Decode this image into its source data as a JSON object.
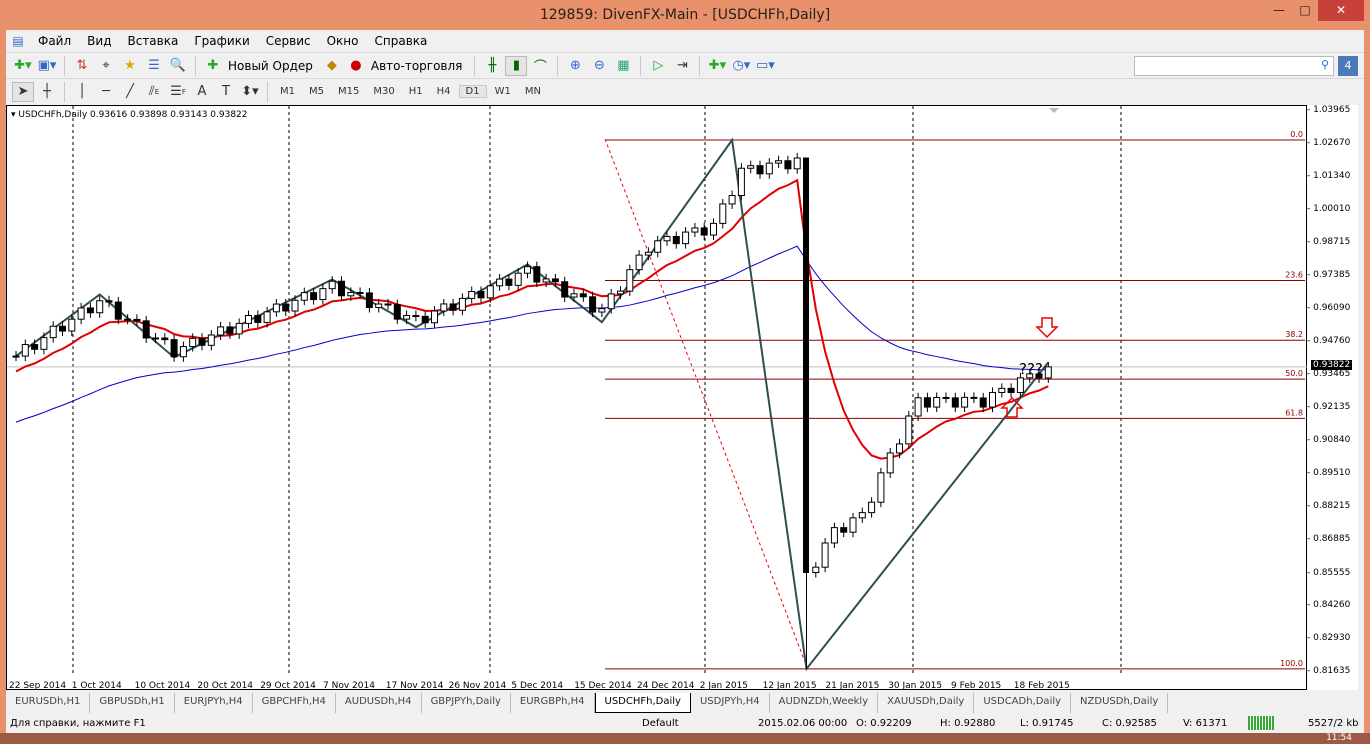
{
  "window": {
    "title": "129859: DivenFX-Main - [USDCHFh,Daily]",
    "minimize": "—",
    "maximize": "□",
    "close": "✕"
  },
  "menu": [
    "Файл",
    "Вид",
    "Вставка",
    "Графики",
    "Сервис",
    "Окно",
    "Справка"
  ],
  "toolbar": {
    "new_order": "Новый Ордер",
    "autotrading": "Авто-торговля"
  },
  "tools": {
    "text": "A",
    "label": "T",
    "fib_e": "E",
    "fib_f": "F"
  },
  "timeframes": [
    "M1",
    "M5",
    "M15",
    "M30",
    "H1",
    "H4",
    "D1",
    "W1",
    "MN"
  ],
  "active_timeframe": "D1",
  "chart": {
    "header": "USDCHFh,Daily  0.93616 0.93898 0.93143 0.93822",
    "current_price": "0.93822",
    "price_ticks": [
      "1.03965",
      "1.02670",
      "1.01340",
      "1.00010",
      "0.98715",
      "0.97385",
      "0.96090",
      "0.94760",
      "0.93465",
      "0.92135",
      "0.90840",
      "0.89510",
      "0.88215",
      "0.86885",
      "0.85555",
      "0.84260",
      "0.82930",
      "0.81635"
    ],
    "date_ticks": [
      "22 Sep 2014",
      "1 Oct 2014",
      "10 Oct 2014",
      "20 Oct 2014",
      "29 Oct 2014",
      "7 Nov 2014",
      "17 Nov 2014",
      "26 Nov 2014",
      "5 Dec 2014",
      "15 Dec 2014",
      "24 Dec 2014",
      "2 Jan 2015",
      "12 Jan 2015",
      "21 Jan 2015",
      "30 Jan 2015",
      "9 Feb 2015",
      "18 Feb 2015"
    ],
    "fib_levels": [
      "0.0",
      "23.6",
      "38.2",
      "50.0",
      "61.8",
      "100.0"
    ],
    "annotation": "???",
    "colors": {
      "bull": "#ffffff",
      "bear": "#000000",
      "ma_fast": "#e00000",
      "ma_slow": "#0000cc",
      "zigzag": "#2f4f4f",
      "fib": "#8b0000"
    },
    "price_waypoints": [
      [
        0,
        0.9425
      ],
      [
        9,
        0.9644
      ],
      [
        17,
        0.9445
      ],
      [
        34,
        0.9704
      ],
      [
        43,
        0.9565
      ],
      [
        55,
        0.9764
      ],
      [
        63,
        0.9605
      ],
      [
        68,
        0.9863
      ],
      [
        75,
        0.9943
      ],
      [
        78,
        1.0162
      ],
      [
        84,
        1.0202
      ],
      [
        85,
        0.855
      ],
      [
        88,
        0.8729
      ],
      [
        91,
        0.8789
      ],
      [
        94,
        0.9027
      ],
      [
        97,
        0.9247
      ],
      [
        104,
        0.9247
      ],
      [
        111,
        0.9382
      ]
    ]
  },
  "tabs": [
    "EURUSDh,H1",
    "GBPUSDh,H1",
    "EURJPYh,H4",
    "GBPCHFh,H4",
    "AUDUSDh,H4",
    "GBPJPYh,Daily",
    "EURGBPh,H4",
    "USDCHFh,Daily",
    "USDJPYh,H4",
    "AUDNZDh,Weekly",
    "XAUUSDh,Daily",
    "USDCADh,Daily",
    "NZDUSDh,Daily"
  ],
  "active_tab": "USDCHFh,Daily",
  "status": {
    "help": "Для справки, нажмите F1",
    "profile": "Default",
    "time": "2015.02.06 00:00",
    "open": "O: 0.92209",
    "high": "H: 0.92880",
    "low": "L: 0.91745",
    "close": "C: 0.92585",
    "volume": "V: 61371",
    "traffic": "5527/2 kb"
  },
  "clock": "11:54"
}
